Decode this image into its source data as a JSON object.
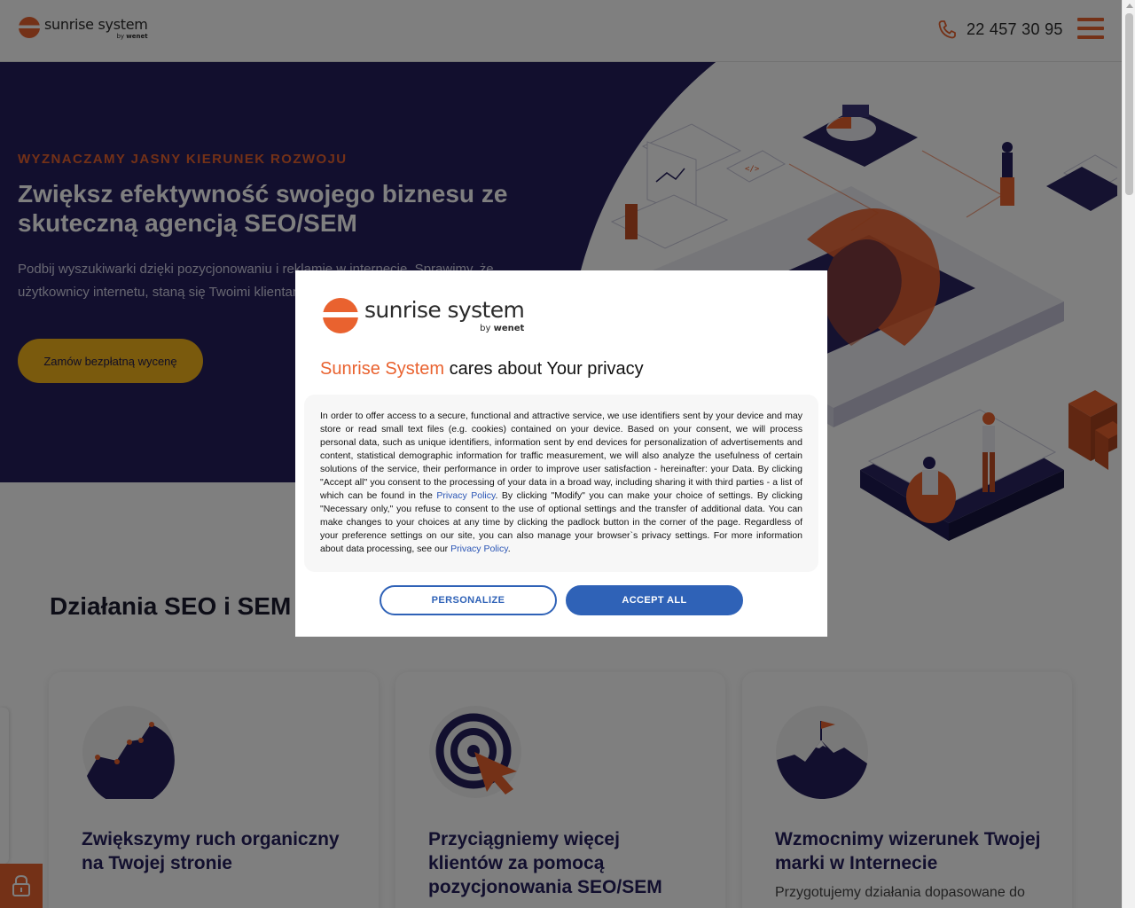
{
  "brand": {
    "name": "sunrise system",
    "by_prefix": "by",
    "by_company": "wenet"
  },
  "header": {
    "phone": "22 457 30 95"
  },
  "hero": {
    "kicker": "WYZNACZAMY JASNY KIERUNEK ROZWOJU",
    "title": "Zwiększ efektywność swojego biznesu ze skuteczną agencją SEO/SEM",
    "subtitle": "Podbij wyszukiwarki dzięki pozycjonowaniu i reklamie w internecie. Sprawimy, że użytkownicy internetu, staną się Twoimi klientami.",
    "cta": "Zamów bezpłatną wycenę"
  },
  "section": {
    "title": "Działania SEO i SEM"
  },
  "cards": [
    {
      "title": "Zwiększymy ruch organiczny na Twojej stronie",
      "text": ""
    },
    {
      "title": "Przyciągniemy więcej klientów za pomocą pozycjonowania SEO/SEM",
      "text": ""
    },
    {
      "title": "Wzmocnimy wizerunek Twojej marki w Internecie",
      "text": "Przygotujemy działania dopasowane do"
    }
  ],
  "modal": {
    "title_brand": "Sunrise System",
    "title_rest": " cares about Your privacy",
    "text_1": "In order to offer access to a secure, functional and attractive service, we use identifiers sent by your device and may store or read small text files (e.g. cookies) contained on your device. Based on your consent, we will process personal data, such as unique identifiers, information sent by end devices for personalization of advertisements and content, statistical demographic information for traffic measurement, we will also analyze the usefulness of certain solutions of the service, their performance in order to improve user satisfaction - hereinafter: your Data. By clicking \"Accept all\" you consent to the processing of your data in a broad way, including sharing it with third parties - a list of which can be found in the ",
    "link_1": "Privacy Policy",
    "text_2": ". By clicking \"Modify\" you can make your choice of settings. By clicking \"Necessary only,\" you refuse to consent to the use of optional settings and the transfer of additional data. You can make changes to your choices at any time by clicking the padlock button in the corner of the page. Regardless of your preference settings on our site, you can also manage your browser`s privacy settings. For more information about data processing, see our ",
    "link_2": "Privacy Policy",
    "text_3": ".",
    "personalize_label": "PERSONALIZE",
    "accept_label": "ACCEPT ALL"
  },
  "colors": {
    "accent": "#e9622f",
    "navy": "#241f5c",
    "cta_yellow": "#f5b41b",
    "button_blue": "#2f62b7",
    "overlay": "rgba(0,0,0,0.5)"
  },
  "icons": {
    "phone": "phone-icon",
    "menu": "hamburger-icon",
    "lock": "padlock-icon",
    "card_1": "growth-chart-icon",
    "card_2": "target-cursor-icon",
    "card_3": "mountain-flag-icon"
  }
}
